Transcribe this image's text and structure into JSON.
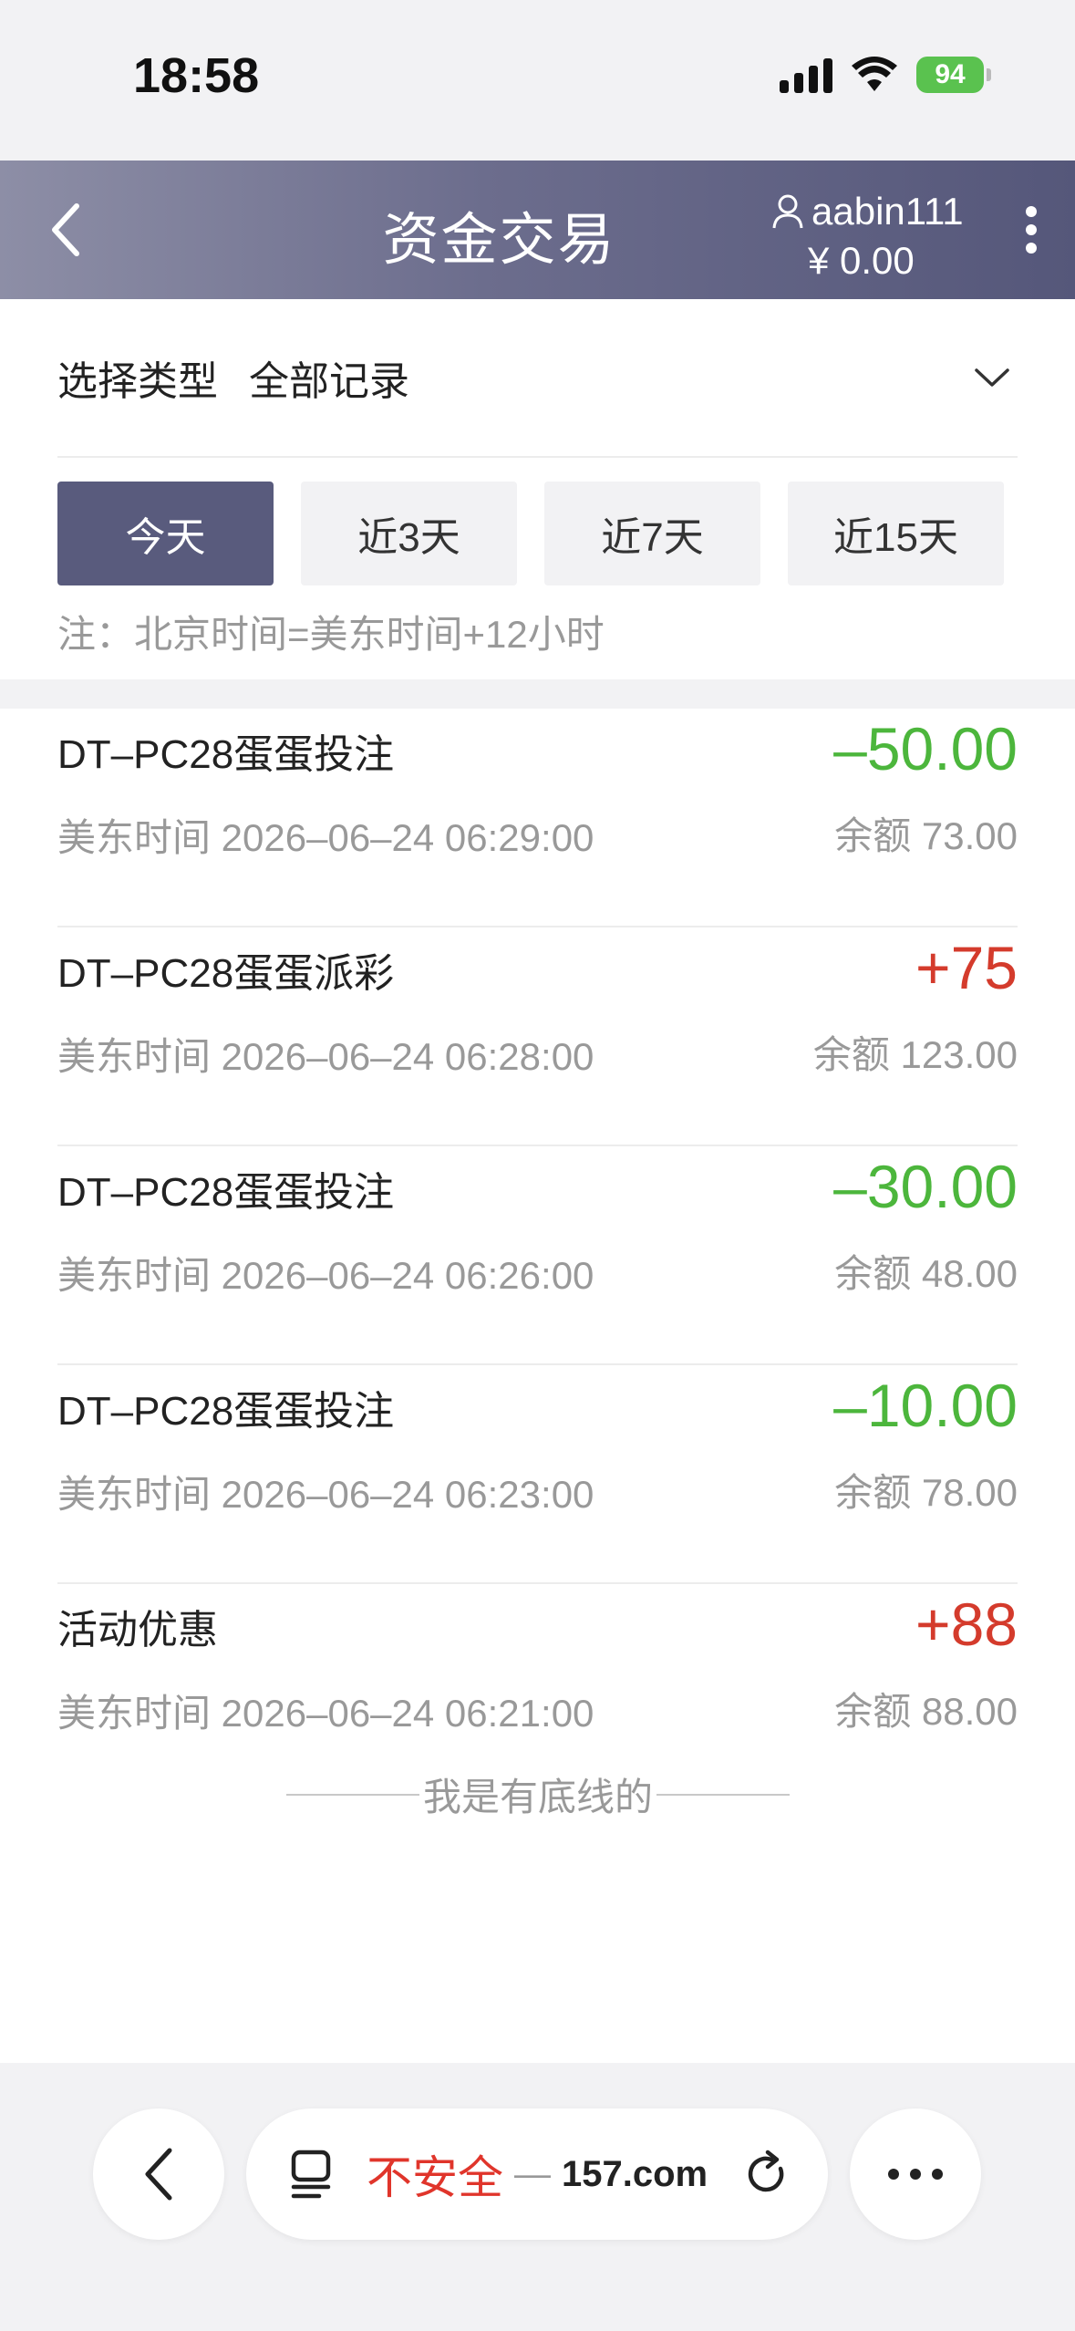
{
  "status_bar": {
    "time": "18:58",
    "battery": "94"
  },
  "header": {
    "title": "资金交易",
    "username": "aabin111",
    "balance": "¥ 0.00"
  },
  "filter": {
    "type_label": "选择类型",
    "type_value": "全部记录",
    "tabs": [
      {
        "label": "今天",
        "active": true
      },
      {
        "label": "近3天",
        "active": false
      },
      {
        "label": "近7天",
        "active": false
      },
      {
        "label": "近15天",
        "active": false
      }
    ],
    "note": "注：北京时间=美东时间+12小时"
  },
  "transactions": [
    {
      "title": "DT–PC28蛋蛋投注",
      "time": "美东时间 2026–06–24 06:29:00",
      "amount": "–50.00",
      "sign": "neg",
      "balance": "余额 73.00"
    },
    {
      "title": "DT–PC28蛋蛋派彩",
      "time": "美东时间 2026–06–24 06:28:00",
      "amount": "+75",
      "sign": "pos",
      "balance": "余额 123.00"
    },
    {
      "title": "DT–PC28蛋蛋投注",
      "time": "美东时间 2026–06–24 06:26:00",
      "amount": "–30.00",
      "sign": "neg",
      "balance": "余额 48.00"
    },
    {
      "title": "DT–PC28蛋蛋投注",
      "time": "美东时间 2026–06–24 06:23:00",
      "amount": "–10.00",
      "sign": "neg",
      "balance": "余额 78.00"
    },
    {
      "title": "活动优惠",
      "time": "美东时间 2026–06–24 06:21:00",
      "amount": "+88",
      "sign": "pos",
      "balance": "余额 88.00"
    }
  ],
  "list_footer": "我是有底线的",
  "browser": {
    "insecure_label": "不安全",
    "separator": "—",
    "domain": "157.com"
  },
  "colors": {
    "header_gradient_start": "#8d8ea6",
    "header_gradient_end": "#55577a",
    "active_tab": "#595b7d",
    "negative_amount": "#4cb63c",
    "positive_amount": "#d43b2c",
    "insecure": "#e0352b"
  },
  "icons": [
    "back-icon",
    "user-icon",
    "more-icon",
    "chevron-down-icon",
    "browser-back-icon",
    "tabs-icon",
    "reload-icon",
    "ellipsis-icon",
    "signal-icon",
    "wifi-icon",
    "battery-icon"
  ]
}
